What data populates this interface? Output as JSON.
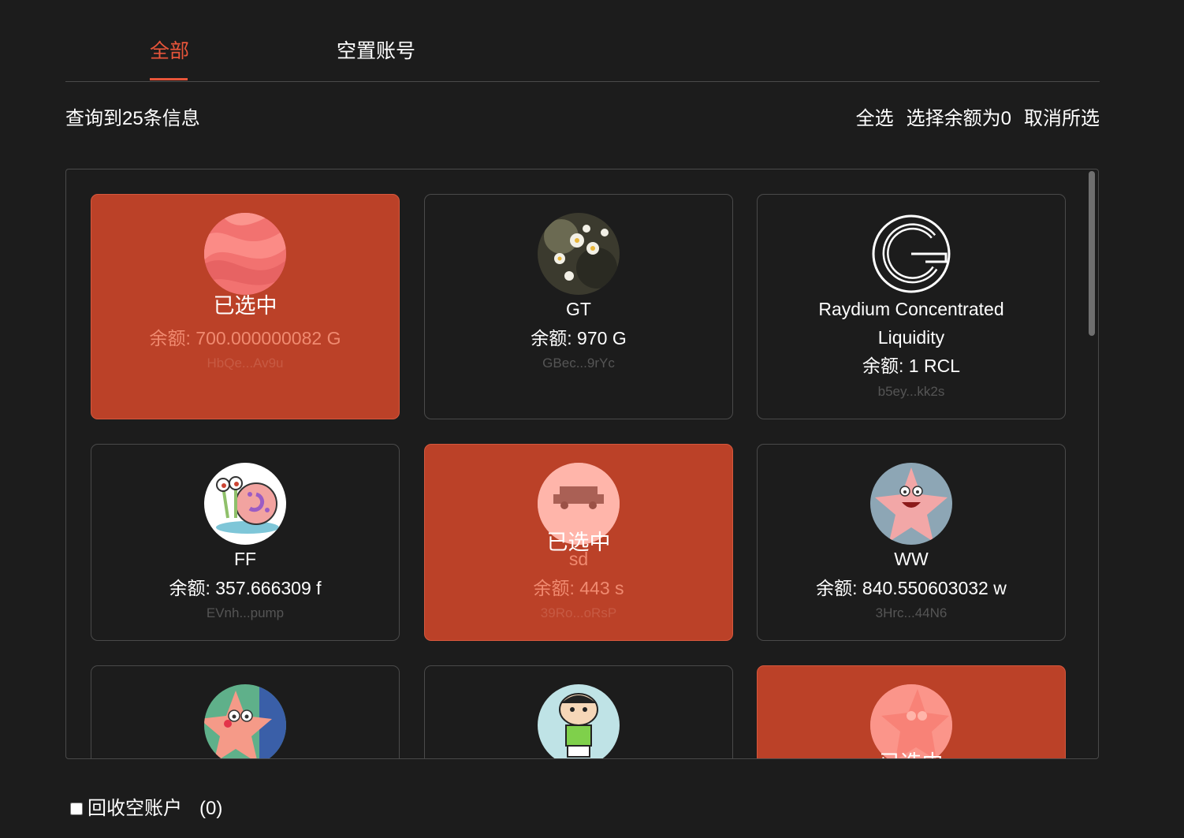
{
  "tabs": [
    {
      "label": "全部",
      "active": true
    },
    {
      "label": "空置账号",
      "active": false
    }
  ],
  "summary": {
    "text": "查询到25条信息"
  },
  "actions": {
    "select_all": "全选",
    "select_zero": "选择余额为0",
    "deselect": "取消所选"
  },
  "selected_label": "已选中",
  "cards": [
    {
      "name": "",
      "balance": "余额: 700.000000082 G",
      "address": "HbQe...Av9u",
      "selected": true,
      "avatar": "pink-abstract-avatar"
    },
    {
      "name": "GT",
      "balance": "余额: 970 G",
      "address": "GBec...9rYc",
      "selected": false,
      "avatar": "daisy-flowers-avatar"
    },
    {
      "name_line1": "Raydium Concentrated",
      "name_line2": "Liquidity",
      "balance": "余额: 1 RCL",
      "address": "b5ey...kk2s",
      "selected": false,
      "avatar": "raydium-logo-avatar"
    },
    {
      "name": "FF",
      "balance": "余额: 357.666309 f",
      "address": "EVnh...pump",
      "selected": false,
      "avatar": "gary-snail-avatar"
    },
    {
      "name": "sd",
      "balance": "余额: 443 s",
      "address": "39Ro...oRsP",
      "selected": true,
      "avatar": "car-silhouette-avatar"
    },
    {
      "name": "WW",
      "balance": "余额: 840.550603032 w",
      "address": "3Hrc...44N6",
      "selected": false,
      "avatar": "patrick-star-avatar"
    },
    {
      "name": "",
      "balance": "",
      "address": "",
      "selected": false,
      "avatar": "patrick-waving-avatar"
    },
    {
      "name": "",
      "balance": "",
      "address": "",
      "selected": false,
      "avatar": "shinchan-avatar"
    },
    {
      "name": "",
      "balance": "",
      "address": "",
      "selected": true,
      "avatar": "patrick-pink-avatar"
    }
  ],
  "footer": {
    "label": "回收空账户",
    "count": "(0)",
    "checked": false
  },
  "colors": {
    "accent": "#e8553a",
    "selected_card": "#bb4128",
    "background": "#1c1c1c"
  }
}
